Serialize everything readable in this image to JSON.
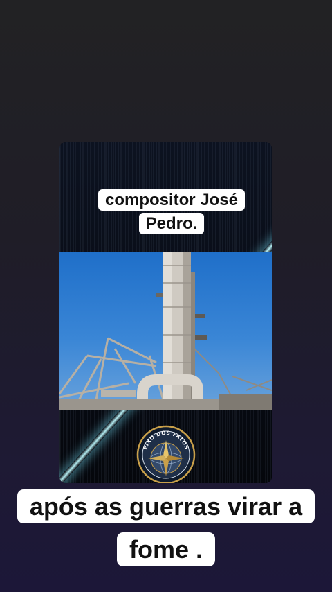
{
  "captions": {
    "top": "compositor José Pedro.",
    "bottom": "após as guerras virar a fome ."
  },
  "logo": {
    "text": "EIXO DOS FATOS",
    "icon": "compass-rose-icon"
  },
  "colors": {
    "background_top": "#222224",
    "background_bottom": "#1c1738",
    "caption_bg": "#ffffff",
    "caption_text": "#111111",
    "sky": "#2f7fd2",
    "beam": "#bff8ff",
    "logo_gold": "#c9a04a"
  }
}
